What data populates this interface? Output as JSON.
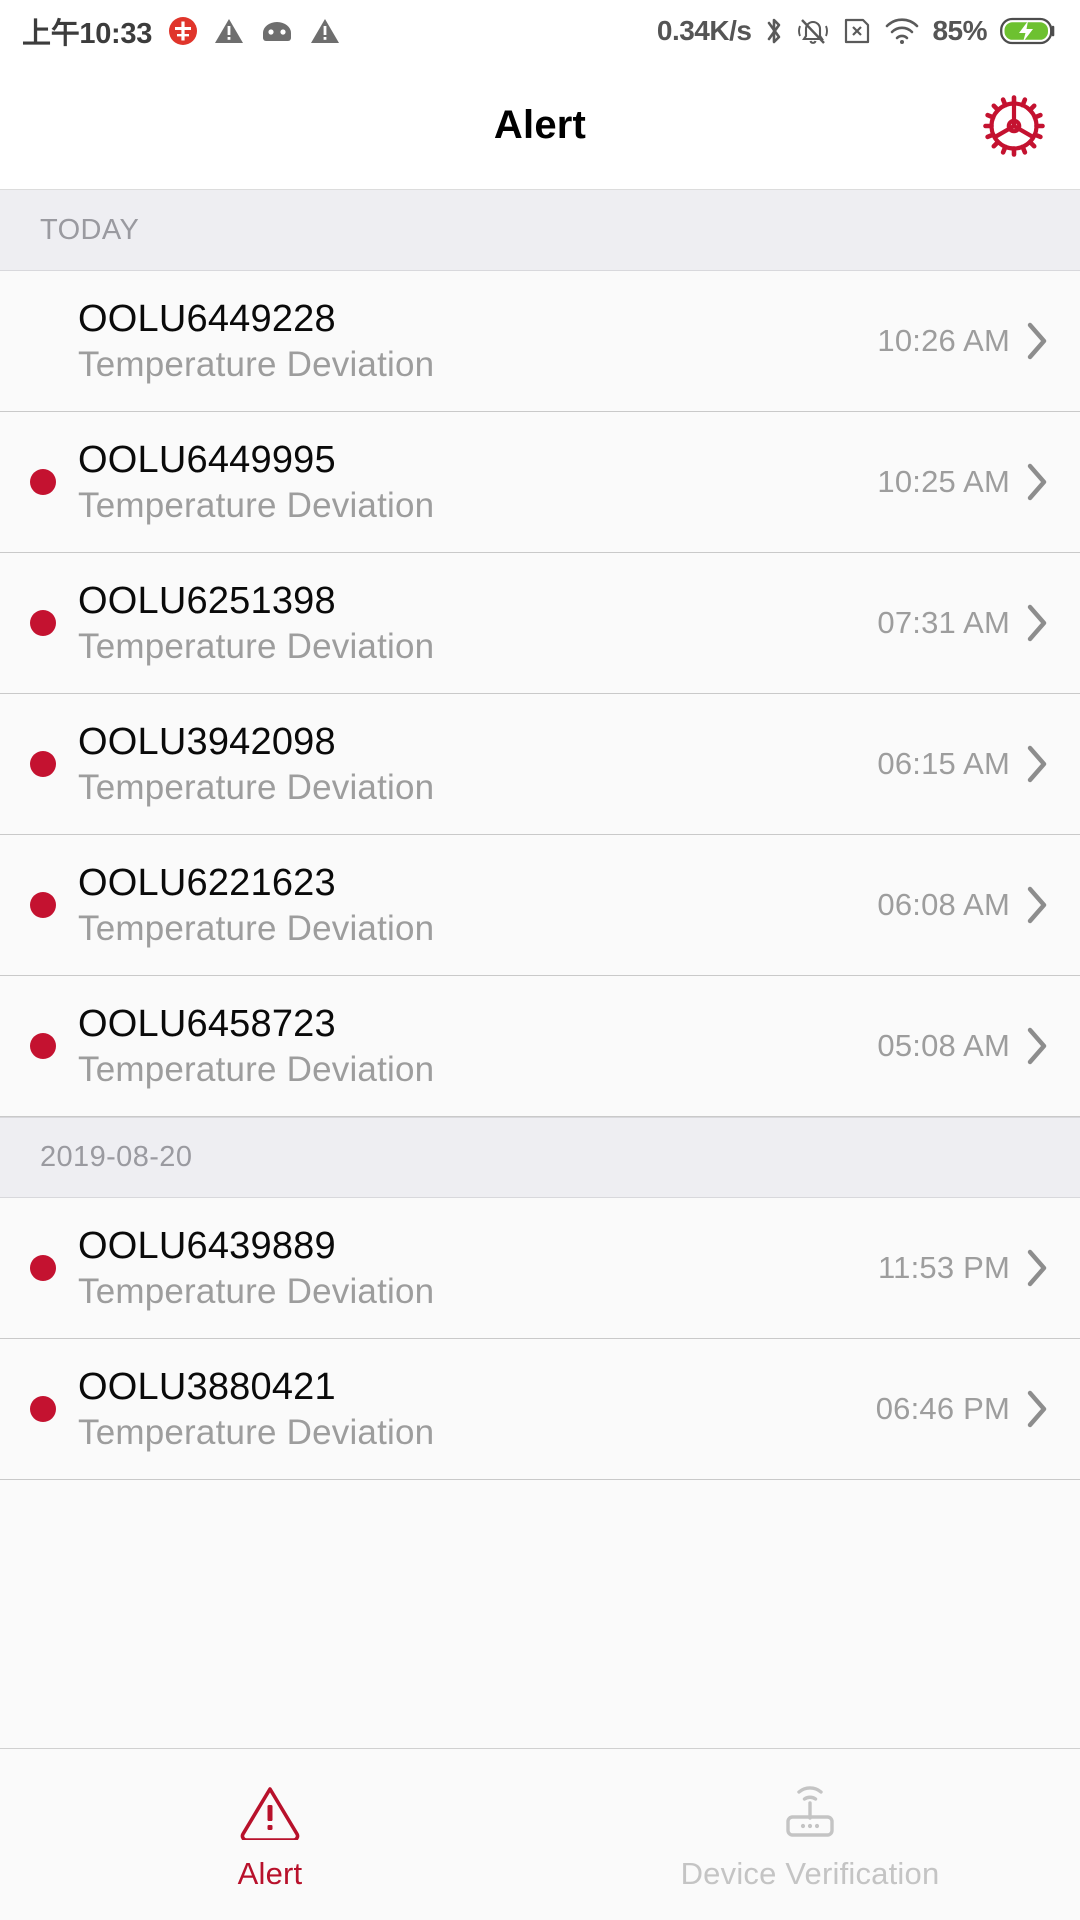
{
  "status_bar": {
    "clock": "上午10:33",
    "net_speed": "0.34K/s",
    "battery_percent": "85%",
    "left_icons": [
      "app-badge-icon",
      "warning-triangle-icon",
      "android-robot-icon",
      "warning-triangle-icon"
    ],
    "right_icons": [
      "bluetooth-icon",
      "silent-bell-icon",
      "sim-card-missing-icon",
      "wifi-icon",
      "battery-charging-icon"
    ],
    "battery_color": "#6dc130"
  },
  "header": {
    "title": "Alert",
    "gear_icon": "gear-icon",
    "gear_color": "#c41230"
  },
  "colors": {
    "accent_red": "#c41230",
    "tab_active_red": "#b8112b",
    "section_bg": "#eeeef2",
    "row_bg": "#fafafa",
    "muted_text": "#9d9d9d"
  },
  "sections": [
    {
      "label": "TODAY",
      "rows": [
        {
          "title": "OOLU6449228",
          "subtitle": "Temperature Deviation",
          "time": "10:26 AM",
          "unread": false
        },
        {
          "title": "OOLU6449995",
          "subtitle": "Temperature Deviation",
          "time": "10:25 AM",
          "unread": true
        },
        {
          "title": "OOLU6251398",
          "subtitle": "Temperature Deviation",
          "time": "07:31 AM",
          "unread": true
        },
        {
          "title": "OOLU3942098",
          "subtitle": "Temperature Deviation",
          "time": "06:15 AM",
          "unread": true
        },
        {
          "title": "OOLU6221623",
          "subtitle": "Temperature Deviation",
          "time": "06:08 AM",
          "unread": true
        },
        {
          "title": "OOLU6458723",
          "subtitle": "Temperature Deviation",
          "time": "05:08 AM",
          "unread": true
        }
      ]
    },
    {
      "label": "2019-08-20",
      "rows": [
        {
          "title": "OOLU6439889",
          "subtitle": "Temperature Deviation",
          "time": "11:53 PM",
          "unread": true
        },
        {
          "title": "OOLU3880421",
          "subtitle": "Temperature Deviation",
          "time": "06:46 PM",
          "unread": true
        }
      ]
    }
  ],
  "bottom_nav": {
    "tabs": [
      {
        "label": "Alert",
        "icon": "warning-triangle-icon",
        "active": true
      },
      {
        "label": "Device Verification",
        "icon": "router-wifi-icon",
        "active": false
      }
    ]
  }
}
